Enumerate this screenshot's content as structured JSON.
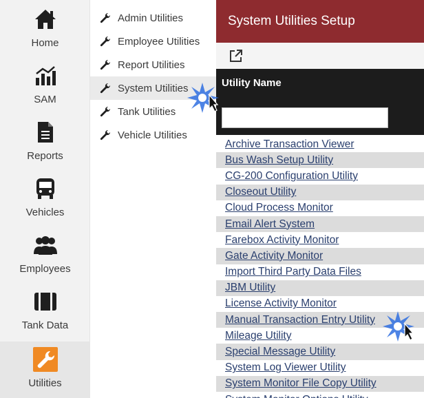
{
  "sidebar": {
    "items": [
      {
        "label": "Home",
        "icon": "home-icon"
      },
      {
        "label": "SAM",
        "icon": "chart-icon"
      },
      {
        "label": "Reports",
        "icon": "document-icon"
      },
      {
        "label": "Vehicles",
        "icon": "bus-icon"
      },
      {
        "label": "Employees",
        "icon": "people-icon"
      },
      {
        "label": "Tank Data",
        "icon": "tank-icon"
      },
      {
        "label": "Utilities",
        "icon": "wrench-icon",
        "active": true
      }
    ]
  },
  "submenu": {
    "items": [
      {
        "label": "Admin Utilities"
      },
      {
        "label": "Employee Utilities"
      },
      {
        "label": "Report Utilities"
      },
      {
        "label": "System Utilities",
        "active": true
      },
      {
        "label": "Tank Utilities"
      },
      {
        "label": "Vehicle Utilities"
      }
    ]
  },
  "main": {
    "title": "System Utilities Setup",
    "column_header": "Utility Name",
    "filter_value": "",
    "rows": [
      "Archive Transaction Viewer",
      "Bus Wash Setup Utility",
      "CG-200 Configuration Utility",
      "Closeout Utility",
      "Cloud Process Monitor",
      "Email Alert System",
      "Farebox Activity Monitor",
      "Gate Activity Monitor",
      "Import Third Party Data Files",
      "JBM Utility",
      "License Activity Monitor",
      "Manual Transaction Entry Utility",
      "Mileage Utility",
      "Special Message Utility",
      "System Log Viewer Utility",
      "System Monitor File Copy Utility",
      "System Monitor Options Utility"
    ]
  },
  "colors": {
    "title_bar": "#8e2b2f",
    "grid_header": "#1c1c1c",
    "active_icon": "#f08a24",
    "link": "#2a3f6e"
  }
}
